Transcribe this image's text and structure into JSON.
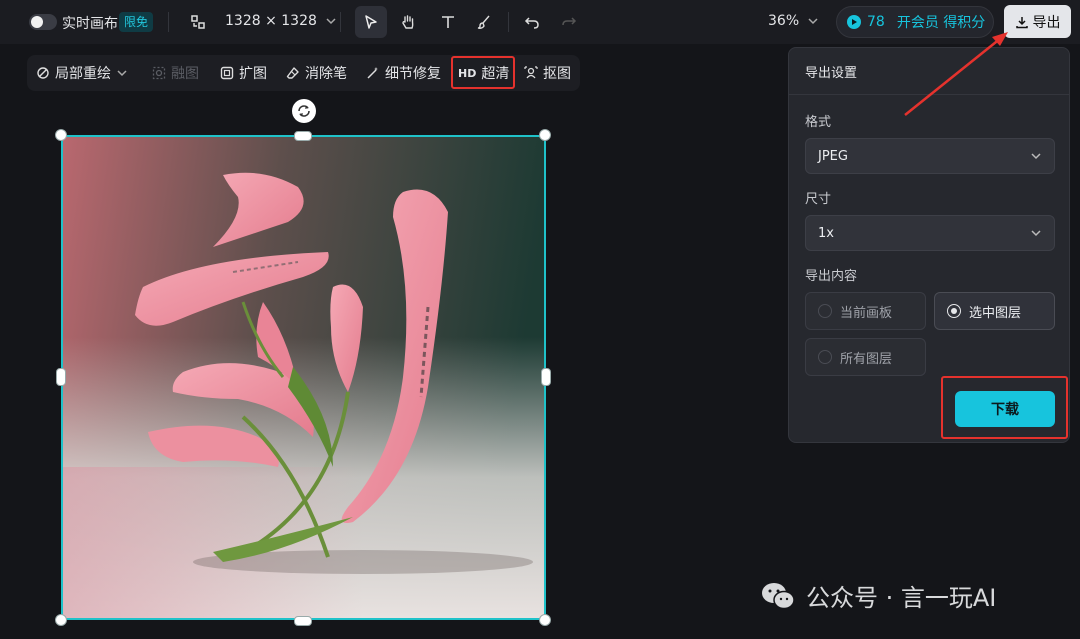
{
  "topbar": {
    "live_canvas": "实时画布",
    "free_badge": "限免",
    "canvas_size": "1328 × 1328",
    "zoom": "36%",
    "credits": "78",
    "member_text": "开会员 得积分",
    "export_label": "导出"
  },
  "toolbar": {
    "local_redraw": "局部重绘",
    "recompose": "融图",
    "expand": "扩图",
    "eraser": "消除笔",
    "detail_fix": "细节修复",
    "hd_badge": "HD",
    "hd_label": "超清",
    "cutout": "抠图"
  },
  "export_panel": {
    "title": "导出设置",
    "format_label": "格式",
    "format_value": "JPEG",
    "size_label": "尺寸",
    "size_value": "1x",
    "content_label": "导出内容",
    "options": [
      {
        "label": "当前画板",
        "selected": false
      },
      {
        "label": "选中图层",
        "selected": true
      },
      {
        "label": "所有图层",
        "selected": false
      }
    ],
    "download_label": "下载"
  },
  "watermark": {
    "text": "公众号 · 言一玩AI"
  },
  "colors": {
    "accent": "#17c4dd",
    "selection": "#1fc2c9",
    "highlight": "#e5322d"
  }
}
